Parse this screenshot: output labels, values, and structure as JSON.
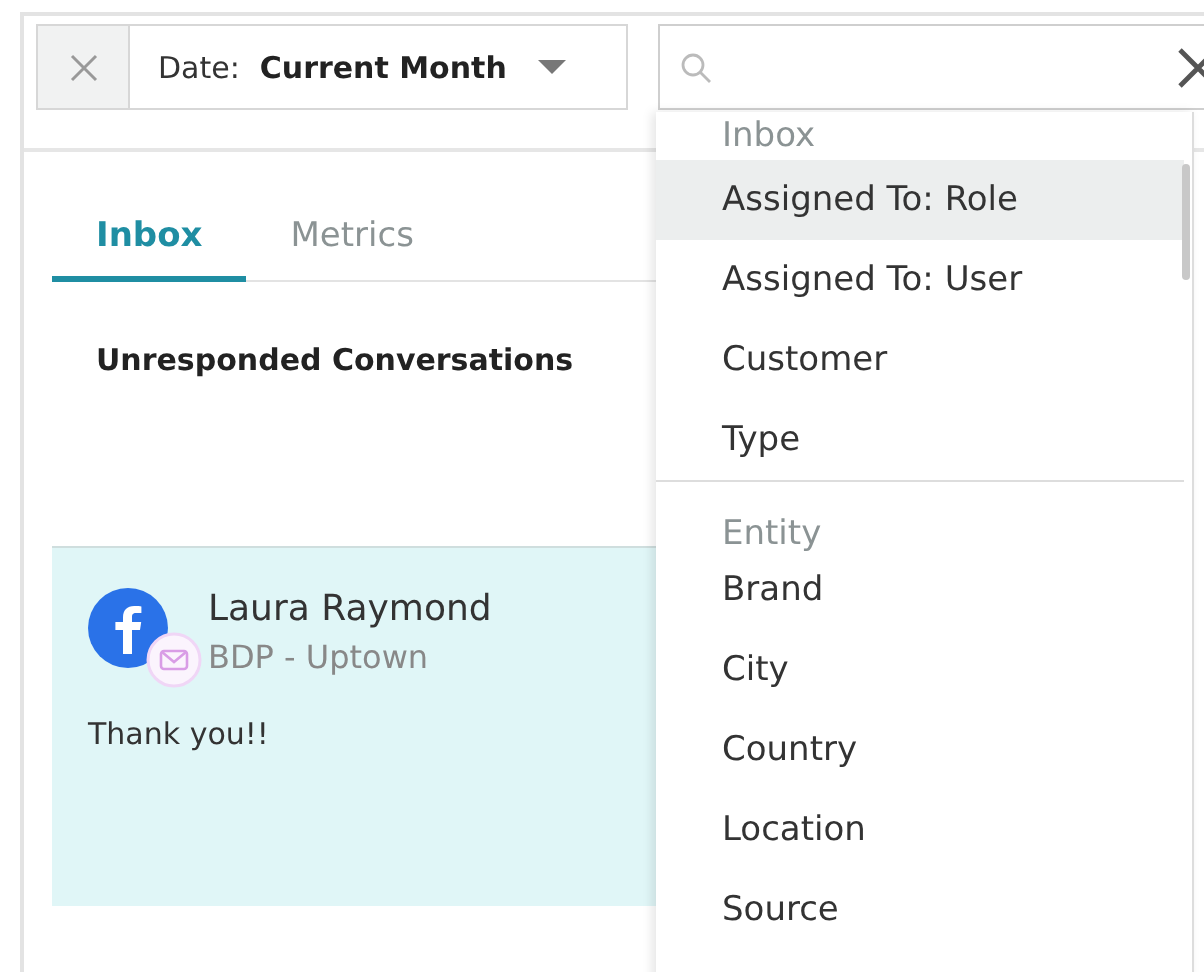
{
  "filter_bar": {
    "date_label": "Date:",
    "date_value": "Current Month"
  },
  "tabs": [
    {
      "label": "Inbox",
      "selected": true
    },
    {
      "label": "Metrics",
      "selected": false
    }
  ],
  "section_title": "Unresponded Conversations",
  "conversation": {
    "name": "Laura Raymond",
    "location": "BDP - Uptown",
    "message": "Thank you!!"
  },
  "dropdown": {
    "groups": [
      {
        "header": "Inbox",
        "items": [
          {
            "label": "Assigned To: Role",
            "selected": true
          },
          {
            "label": "Assigned To: User",
            "selected": false
          },
          {
            "label": "Customer",
            "selected": false
          },
          {
            "label": "Type",
            "selected": false
          }
        ]
      },
      {
        "header": "Entity",
        "items": [
          {
            "label": "Brand",
            "selected": false
          },
          {
            "label": "City",
            "selected": false
          },
          {
            "label": "Country",
            "selected": false
          },
          {
            "label": "Location",
            "selected": false
          },
          {
            "label": "Source",
            "selected": false
          }
        ]
      }
    ]
  }
}
